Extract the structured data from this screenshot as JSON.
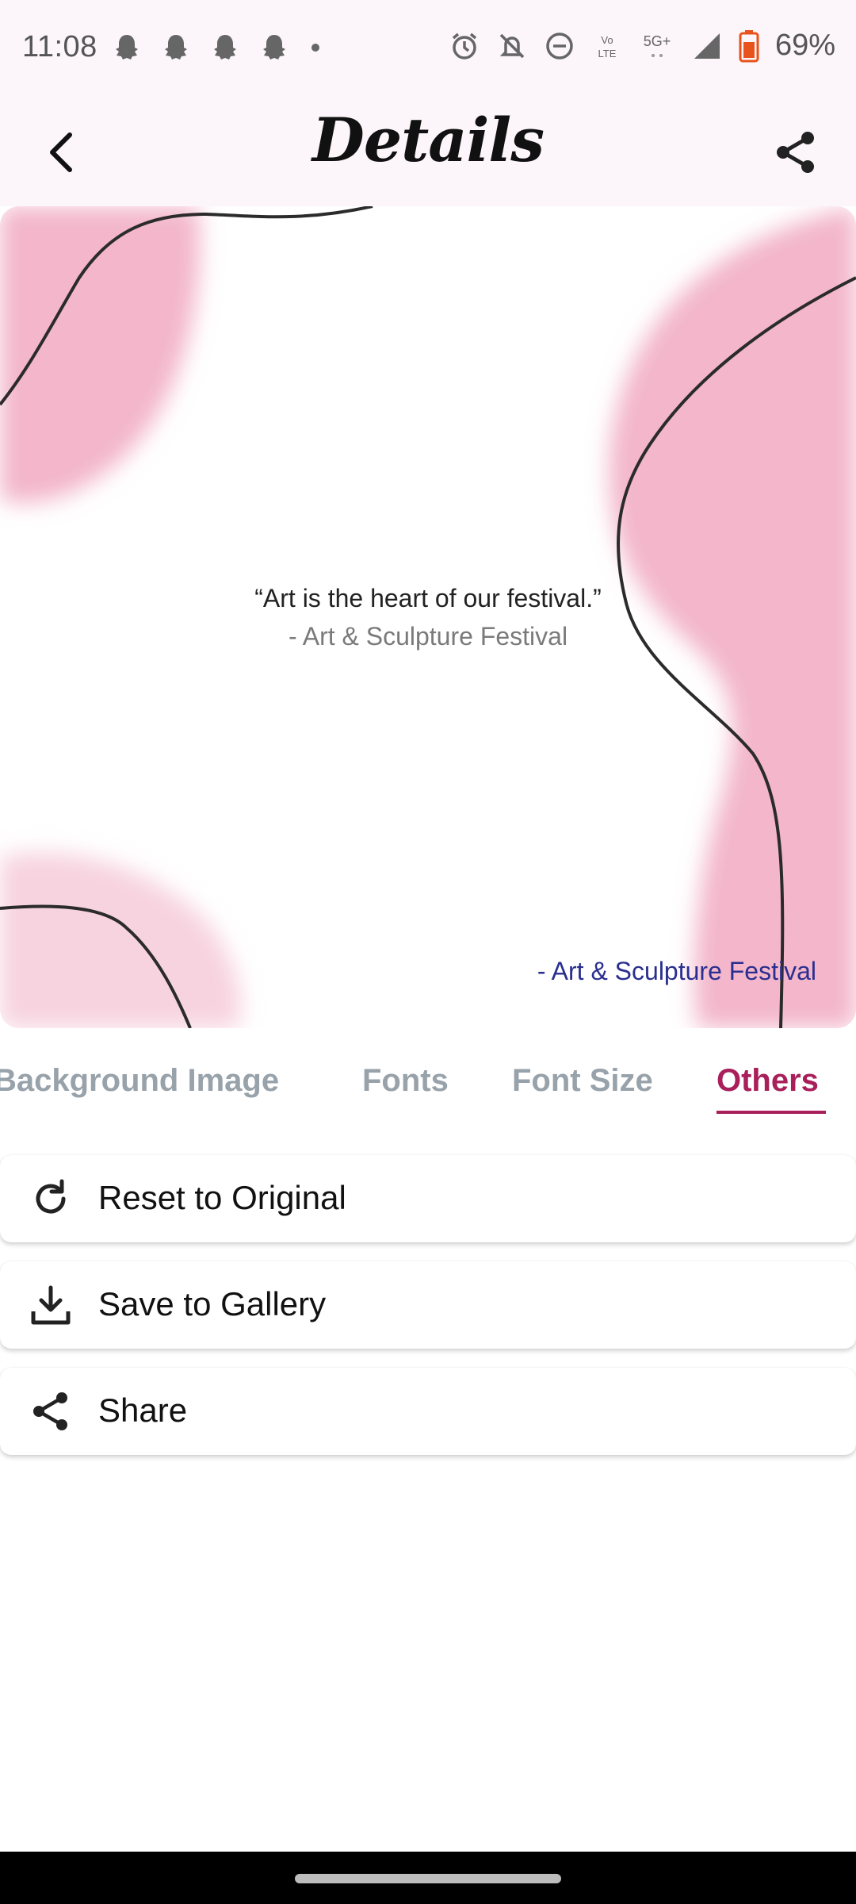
{
  "status_bar": {
    "time": "11:08",
    "battery": "69%",
    "network": "5G+",
    "left_icons": [
      "snapchat-icon",
      "snapchat-icon",
      "snapchat-icon",
      "snapchat-icon",
      "dot-icon"
    ],
    "right_icons": [
      "alarm-icon",
      "bell-off-icon",
      "dnd-icon",
      "volte-icon",
      "5g-icon",
      "signal-icon",
      "battery-icon"
    ]
  },
  "app_bar": {
    "title": "Details",
    "back_icon": "chevron-left-icon",
    "share_icon": "share-icon"
  },
  "preview": {
    "quote": "“Art is the heart of our festival.”",
    "author": "- Art & Sculpture Festival",
    "signature": "- Art & Sculpture Festival",
    "colors": {
      "blob": "#f3b6ca",
      "blob_light": "#f7d3df",
      "line": "#2b2b2b",
      "signature": "#2a2f8f"
    }
  },
  "tabs": [
    {
      "label": "Background Image",
      "active": false
    },
    {
      "label": "Fonts",
      "active": false
    },
    {
      "label": "Font Size",
      "active": false
    },
    {
      "label": "Others",
      "active": true
    }
  ],
  "options": [
    {
      "label": "Reset to Original",
      "icon": "refresh-icon"
    },
    {
      "label": "Save to Gallery",
      "icon": "download-icon"
    },
    {
      "label": "Share",
      "icon": "share-icon"
    }
  ],
  "accent_color": "#a81f5a"
}
